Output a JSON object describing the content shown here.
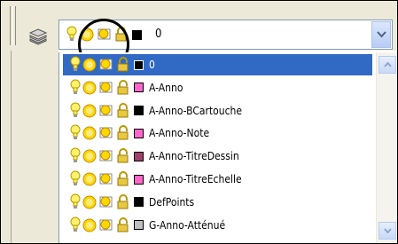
{
  "current_layer": {
    "name": "0",
    "color": "#000000"
  },
  "layers": [
    {
      "name": "0",
      "color": "#000000",
      "selected": true
    },
    {
      "name": "A-Anno",
      "color": "#ff66cc"
    },
    {
      "name": "A-Anno-BCartouche",
      "color": "#000000"
    },
    {
      "name": "A-Anno-Note",
      "color": "#ff66cc"
    },
    {
      "name": "A-Anno-TitreDessin",
      "color": "#a0406a"
    },
    {
      "name": "A-Anno-TitreEchelle",
      "color": "#ff66cc"
    },
    {
      "name": "DefPoints",
      "color": "#000000"
    },
    {
      "name": "G-Anno-Atténué",
      "color": "#c0c0c0"
    }
  ],
  "icons": {
    "layer_manager": "layer-stack-icon",
    "on_off": "lightbulb-icon",
    "freeze": "sun-icon",
    "viewport_freeze": "viewport-freeze-icon",
    "lock": "padlock-icon",
    "dropdown": "chevron-down-icon"
  },
  "colors": {
    "selection": "#316ac5",
    "bulb": "#fff26b",
    "sun": "#ffd700",
    "lock": "#e8c840"
  }
}
